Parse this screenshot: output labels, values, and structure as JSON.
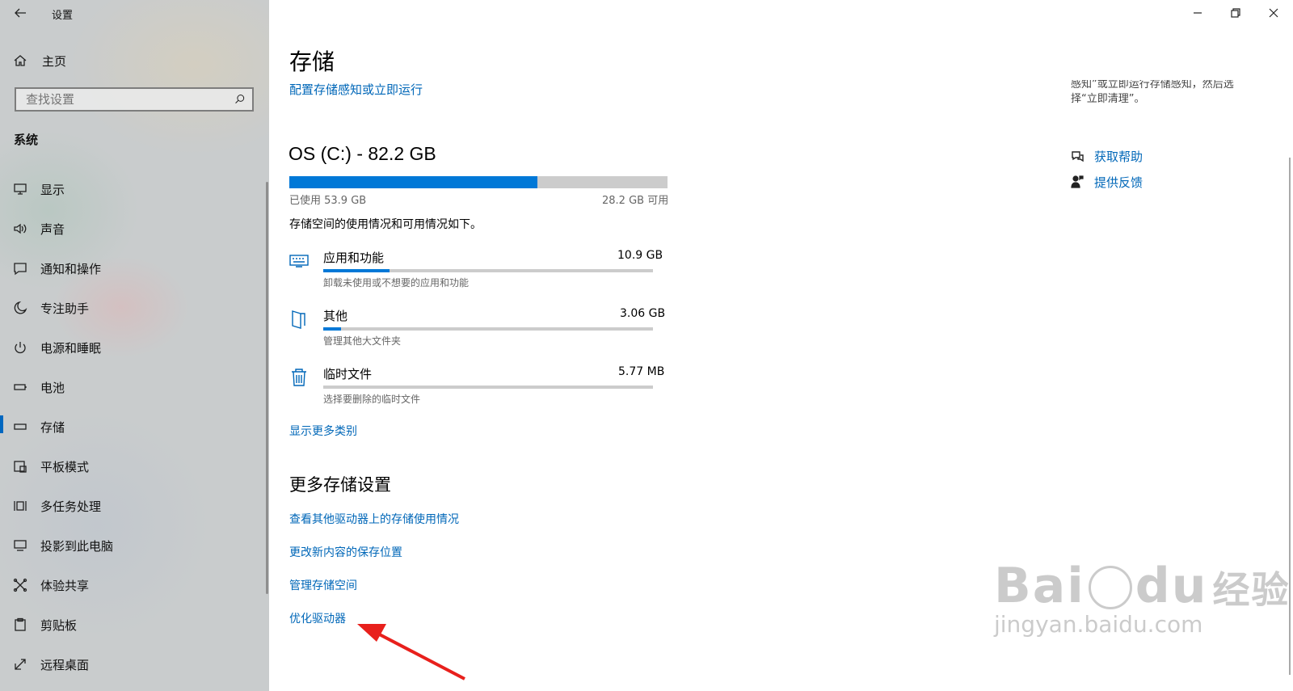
{
  "window": {
    "title": "设置"
  },
  "sidebar": {
    "home_label": "主页",
    "search_placeholder": "查找设置",
    "section_label": "系统",
    "items": [
      {
        "label": "显示",
        "icon": "monitor-icon"
      },
      {
        "label": "声音",
        "icon": "speaker-icon"
      },
      {
        "label": "通知和操作",
        "icon": "notification-icon"
      },
      {
        "label": "专注助手",
        "icon": "moon-icon"
      },
      {
        "label": "电源和睡眠",
        "icon": "power-icon"
      },
      {
        "label": "电池",
        "icon": "battery-icon"
      },
      {
        "label": "存储",
        "icon": "storage-icon",
        "selected": true
      },
      {
        "label": "平板模式",
        "icon": "tablet-icon"
      },
      {
        "label": "多任务处理",
        "icon": "multitask-icon"
      },
      {
        "label": "投影到此电脑",
        "icon": "project-icon"
      },
      {
        "label": "体验共享",
        "icon": "share-icon"
      },
      {
        "label": "剪贴板",
        "icon": "clipboard-icon"
      },
      {
        "label": "远程桌面",
        "icon": "remote-desktop-icon"
      }
    ]
  },
  "main": {
    "page_title": "存储",
    "storage_sense_link": "配置存储感知或立即运行",
    "drive": {
      "title": "OS (C:) - 82.2 GB",
      "used_label": "已使用 53.9 GB",
      "free_label": "28.2 GB 可用",
      "used_fraction": 0.656
    },
    "usage_desc": "存储空间的使用情况和可用情况如下。",
    "categories": [
      {
        "name": "应用和功能",
        "size": "10.9 GB",
        "desc": "卸载未使用或不想要的应用和功能",
        "fraction": 0.2,
        "icon": "keyboard-icon"
      },
      {
        "name": "其他",
        "size": "3.06 GB",
        "desc": "管理其他大文件夹",
        "fraction": 0.055,
        "icon": "document-icon"
      },
      {
        "name": "临时文件",
        "size": "5.77 MB",
        "desc": "选择要删除的临时文件",
        "fraction": 0.0,
        "icon": "trash-icon"
      }
    ],
    "show_more_link": "显示更多类别",
    "more_settings_heading": "更多存储设置",
    "more_links": [
      "查看其他驱动器上的存储使用情况",
      "更改新内容的保存位置",
      "管理存储空间",
      "优化驱动器"
    ]
  },
  "right_panel": {
    "tip_line1": "感知”或立即运行存储感知，然后选",
    "tip_line2": "择“立即清理”。",
    "help_link": "获取帮助",
    "feedback_link": "提供反馈"
  },
  "watermark": {
    "line1": "Bai",
    "line2": "du",
    "line3": "经验",
    "url": "jingyan.baidu.com"
  },
  "colors": {
    "accent": "#0067b8",
    "bar_fill": "#0078d7",
    "bar_track": "#cccccc",
    "arrow": "#e8201c"
  }
}
